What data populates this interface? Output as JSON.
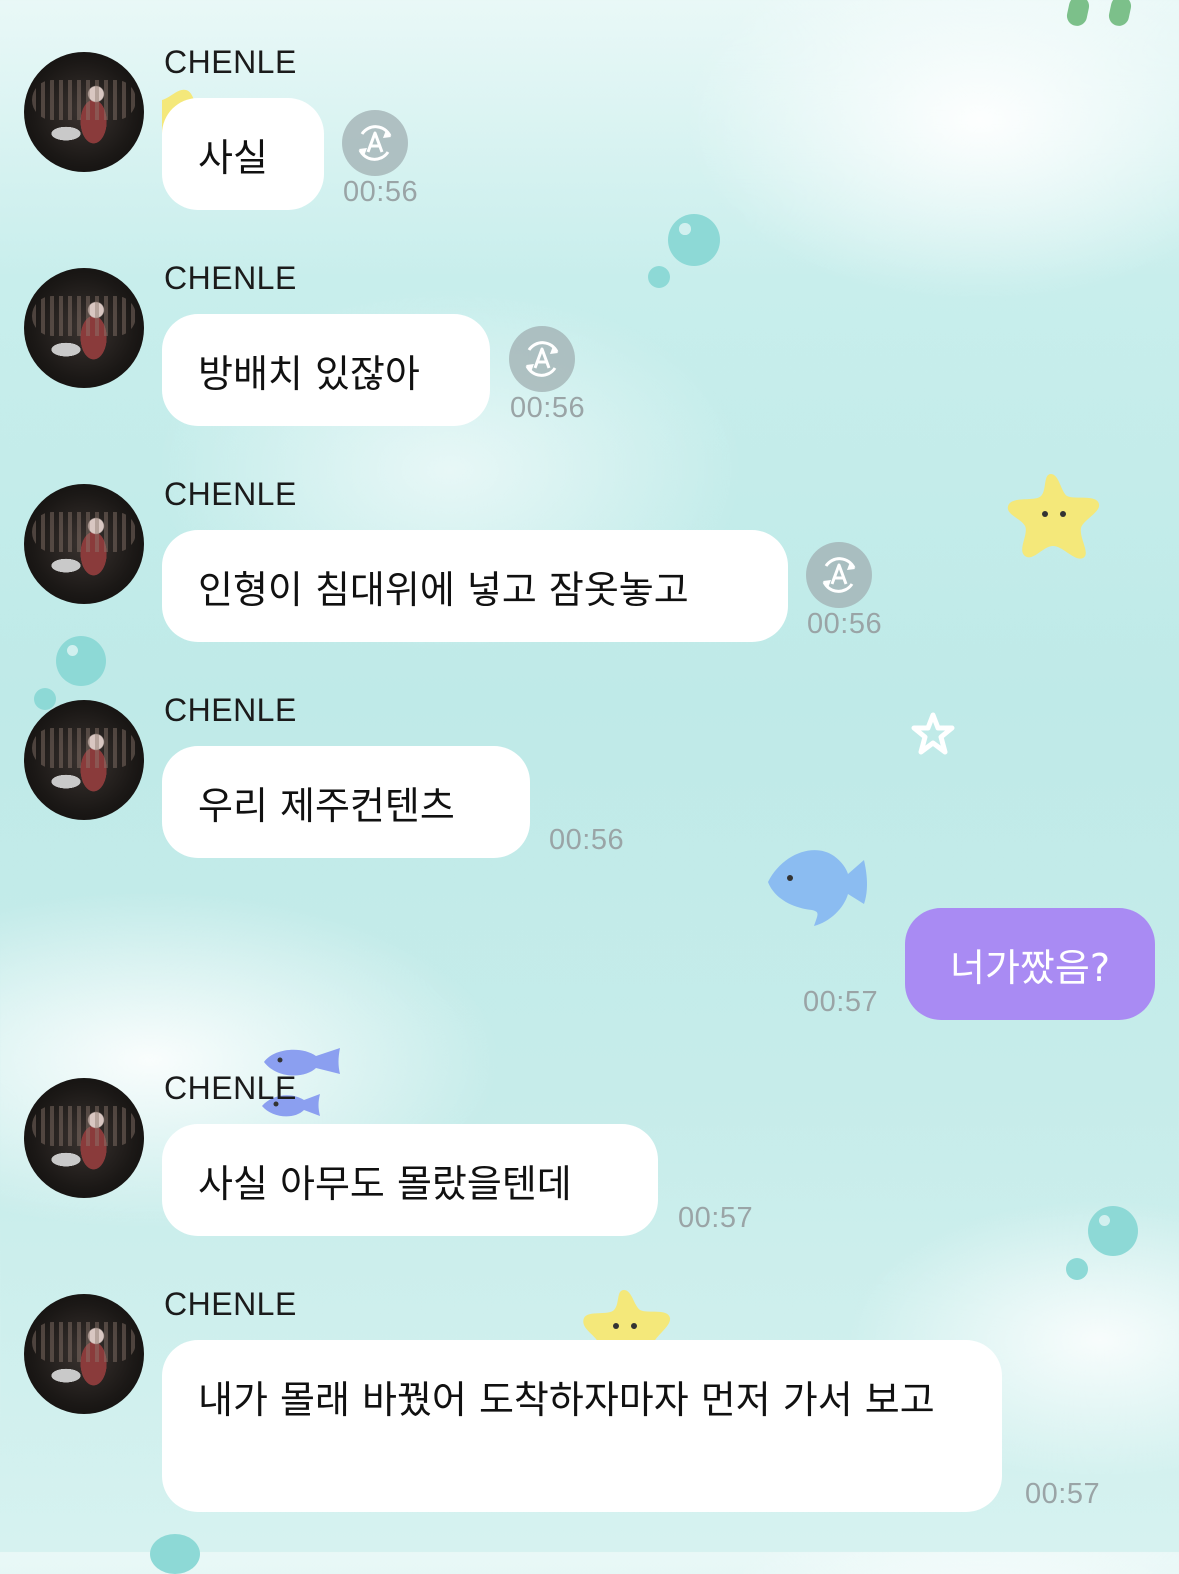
{
  "chat": {
    "messages": [
      {
        "sender": "CHENLE",
        "text": "사실",
        "time": "00:56",
        "translate": true
      },
      {
        "sender": "CHENLE",
        "text": "방배치 있잖아",
        "time": "00:56",
        "translate": true
      },
      {
        "sender": "CHENLE",
        "text": "인형이 침대위에 넣고 잠옷놓고",
        "time": "00:56",
        "translate": true
      },
      {
        "sender": "CHENLE",
        "text": "우리 제주컨텐츠",
        "time": "00:56",
        "translate": false
      },
      {
        "sender": "me",
        "text": "너가짰음?",
        "time": "00:57"
      },
      {
        "sender": "CHENLE",
        "text": "사실 아무도 몰랐을텐데",
        "time": "00:57",
        "translate": false
      },
      {
        "sender": "CHENLE",
        "text": "내가 몰래 바꿨어 도착하자마자 먼저 가서 보고",
        "time": "00:57",
        "translate": false
      }
    ]
  },
  "colors": {
    "my_bubble": "#a98bf3",
    "their_bubble": "#ffffff",
    "timestamp": "#9aa4a6",
    "background": "#c8eeec"
  },
  "icons": {
    "translate": "auto-translate-icon",
    "decorations": [
      "star-sticker",
      "fish-sticker",
      "bubble-dots",
      "sparkle-star"
    ]
  }
}
